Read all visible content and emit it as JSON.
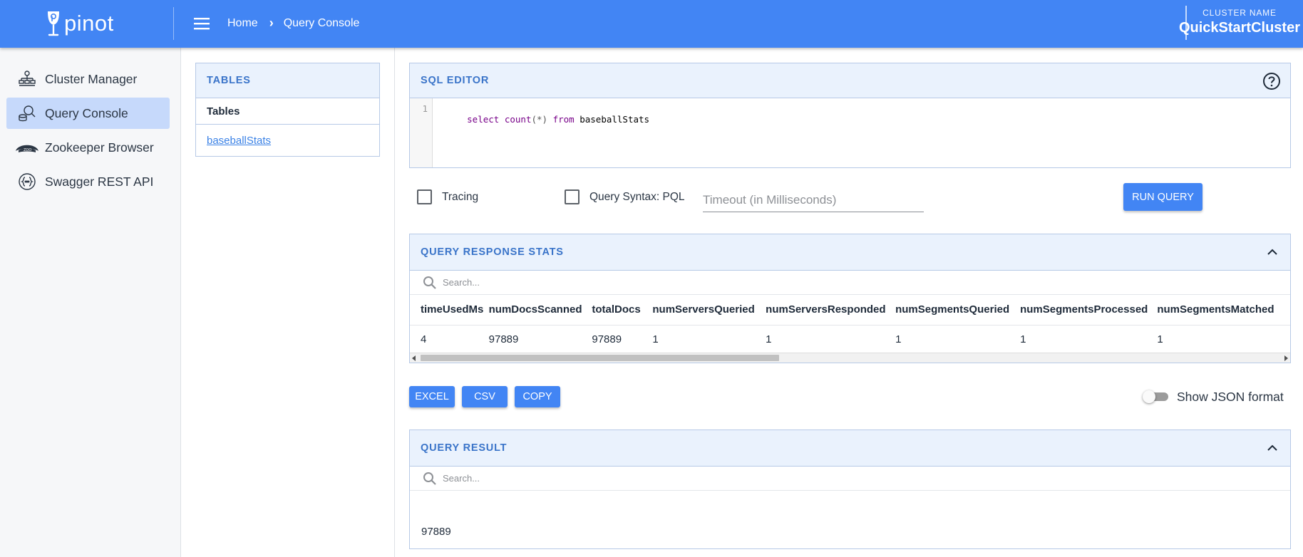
{
  "header": {
    "logo_text": "pinot",
    "breadcrumb": [
      "Home",
      "Query Console"
    ],
    "cluster_label": "CLUSTER NAME",
    "cluster_name": "QuickStartCluster"
  },
  "sidebar": {
    "items": [
      {
        "label": "Cluster Manager",
        "icon": "cluster-icon",
        "active": false
      },
      {
        "label": "Query Console",
        "icon": "query-icon",
        "active": true
      },
      {
        "label": "Zookeeper Browser",
        "icon": "zookeeper-icon",
        "active": false
      },
      {
        "label": "Swagger REST API",
        "icon": "api-icon",
        "active": false
      }
    ]
  },
  "tables_panel": {
    "title": "TABLES",
    "column_header": "Tables",
    "rows": [
      "baseballStats"
    ]
  },
  "sql_editor": {
    "title": "SQL EDITOR",
    "line_number": "1",
    "query_tokens": [
      {
        "text": "select",
        "kind": "kw"
      },
      {
        "text": " ",
        "kind": "tx"
      },
      {
        "text": "count",
        "kind": "kw"
      },
      {
        "text": "(*)",
        "kind": "pn"
      },
      {
        "text": " ",
        "kind": "tx"
      },
      {
        "text": "from",
        "kind": "kw"
      },
      {
        "text": " baseballStats",
        "kind": "tx"
      }
    ]
  },
  "options": {
    "tracing_label": "Tracing",
    "tracing_checked": false,
    "pql_label": "Query Syntax: PQL",
    "pql_checked": false,
    "timeout_placeholder": "Timeout (in Milliseconds)",
    "timeout_value": "",
    "run_label": "RUN QUERY"
  },
  "stats_panel": {
    "title": "QUERY RESPONSE STATS",
    "search_placeholder": "Search...",
    "columns": [
      "timeUsedMs",
      "numDocsScanned",
      "totalDocs",
      "numServersQueried",
      "numServersResponded",
      "numSegmentsQueried",
      "numSegmentsProcessed",
      "numSegmentsMatched"
    ],
    "row": [
      "4",
      "97889",
      "97889",
      "1",
      "1",
      "1",
      "1",
      "1"
    ]
  },
  "export": {
    "excel_label": "EXCEL",
    "csv_label": "CSV",
    "copy_label": "COPY",
    "json_toggle_label": "Show JSON format",
    "json_toggle_on": false
  },
  "result_panel": {
    "title": "QUERY RESULT",
    "search_placeholder": "Search...",
    "value": "97889"
  },
  "colors": {
    "primary": "#4285f4",
    "panel_header_bg": "#eaf2fd",
    "panel_title": "#3a74c9",
    "active_nav_bg": "#c6d9fb",
    "sql_keyword": "#770088"
  }
}
